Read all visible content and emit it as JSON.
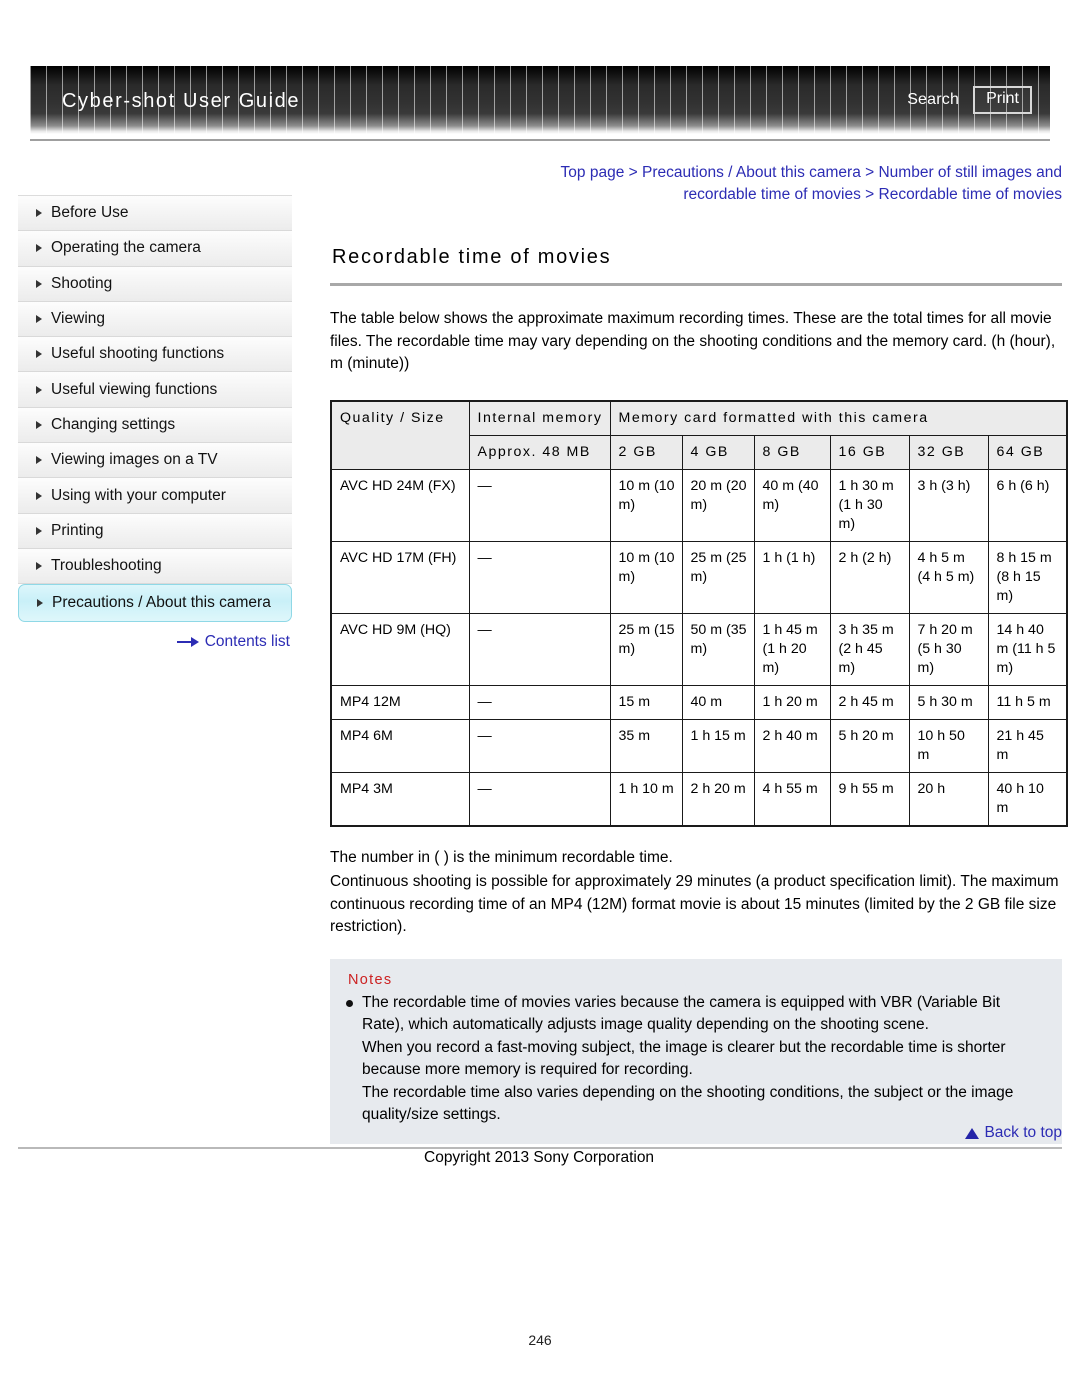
{
  "header": {
    "title": "Cyber-shot User Guide",
    "search_label": "Search",
    "print_label": "Print"
  },
  "breadcrumb": {
    "text": "Top page > Precautions / About this camera > Number of still images and recordable time of movies > Recordable time of movies"
  },
  "sidebar": {
    "items": [
      {
        "label": "Before Use",
        "active": false
      },
      {
        "label": "Operating the camera",
        "active": false
      },
      {
        "label": "Shooting",
        "active": false
      },
      {
        "label": "Viewing",
        "active": false
      },
      {
        "label": "Useful shooting functions",
        "active": false
      },
      {
        "label": "Useful viewing functions",
        "active": false
      },
      {
        "label": "Changing settings",
        "active": false
      },
      {
        "label": "Viewing images on a TV",
        "active": false
      },
      {
        "label": "Using with your computer",
        "active": false
      },
      {
        "label": "Printing",
        "active": false
      },
      {
        "label": "Troubleshooting",
        "active": false
      },
      {
        "label": "Precautions / About this camera",
        "active": true
      }
    ],
    "contents_link": "Contents list"
  },
  "main": {
    "title": "Recordable time of movies",
    "intro": "The table below shows the approximate maximum recording times. These are the total times for all movie files. The recordable time may vary depending on the shooting conditions and the memory card. (h (hour), m (minute))",
    "table": {
      "header": {
        "quality_size": "Quality / Size",
        "internal_memory": "Internal memory",
        "memory_card_group": "Memory card formatted with this camera",
        "internal_capacity": "Approx. 48 MB",
        "card_capacities": [
          "2 GB",
          "4 GB",
          "8 GB",
          "16 GB",
          "32 GB",
          "64 GB"
        ]
      },
      "rows": [
        {
          "quality": "AVC HD 24M (FX)",
          "internal": "—",
          "cells": [
            "10 m (10 m)",
            "20 m (20 m)",
            "40 m (40 m)",
            "1 h 30 m (1 h 30 m)",
            "3 h (3 h)",
            "6 h (6 h)"
          ]
        },
        {
          "quality": "AVC HD 17M (FH)",
          "internal": "—",
          "cells": [
            "10 m (10 m)",
            "25 m (25 m)",
            "1 h (1 h)",
            "2 h (2 h)",
            "4 h 5 m (4 h 5 m)",
            "8 h 15 m (8 h 15 m)"
          ]
        },
        {
          "quality": "AVC HD 9M (HQ)",
          "internal": "—",
          "cells": [
            "25 m (15 m)",
            "50 m (35 m)",
            "1 h 45 m (1 h 20 m)",
            "3 h 35 m (2 h 45 m)",
            "7 h 20 m (5 h 30 m)",
            "14 h 40 m (11 h 5 m)"
          ]
        },
        {
          "quality": "MP4 12M",
          "internal": "—",
          "cells": [
            "15 m",
            "40 m",
            "1 h 20 m",
            "2 h 45 m",
            "5 h 30 m",
            "11 h 5 m"
          ]
        },
        {
          "quality": "MP4 6M",
          "internal": "—",
          "cells": [
            "35 m",
            "1 h 15 m",
            "2 h 40 m",
            "5 h 20 m",
            "10 h 50 m",
            "21 h 45 m"
          ]
        },
        {
          "quality": "MP4 3M",
          "internal": "—",
          "cells": [
            "1 h 10 m",
            "2 h 20 m",
            "4 h 55 m",
            "9 h 55 m",
            "20 h",
            "40 h 10 m"
          ]
        }
      ]
    },
    "after_table": {
      "line1": "The number in ( ) is the minimum recordable time.",
      "line2": "Continuous shooting is possible for approximately 29 minutes (a product specification limit). The maximum continuous recording time of an MP4 (12M) format movie is about 15 minutes (limited by the 2 GB file size restriction)."
    },
    "notes": {
      "title": "Notes",
      "paragraphs": [
        "The recordable time of movies varies because the camera is equipped with VBR (Variable Bit Rate), which automatically adjusts image quality depending on the shooting scene.",
        "When you record a fast-moving subject, the image is clearer but the recordable time is shorter because more memory is required for recording.",
        "The recordable time also varies depending on the shooting conditions, the subject or the image quality/size settings."
      ]
    }
  },
  "footer": {
    "back_to_top": "Back to top",
    "copyright": "Copyright 2013 Sony Corporation",
    "page_number": "246"
  }
}
